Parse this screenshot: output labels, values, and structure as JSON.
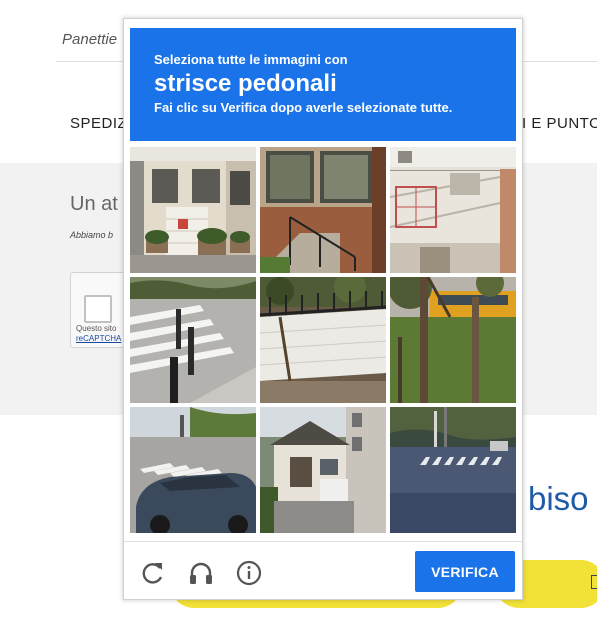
{
  "background": {
    "breadcrumb": "Panettie",
    "nav_left": "SPEDIZ",
    "nav_right": "I E PUNTO",
    "heading": "Un at",
    "subtext": "Abbiamo b",
    "recaptcha_line1": "Questo sito",
    "recaptcha_line2": "reCAPTCHA",
    "big_text": "biso"
  },
  "captcha": {
    "instruction_line1": "Seleziona tutte le immagini con",
    "target_object": "strisce pedonali",
    "instruction_line3": "Fai clic su Verifica dopo averle selezionate tutte.",
    "tiles": [
      {
        "name": "tile-1",
        "subject": "house with garage and plant pots"
      },
      {
        "name": "tile-2",
        "subject": "brick building with stair railing"
      },
      {
        "name": "tile-3",
        "subject": "white building with balconies"
      },
      {
        "name": "tile-4",
        "subject": "crosswalk with bollards"
      },
      {
        "name": "tile-5",
        "subject": "wall with iron fence"
      },
      {
        "name": "tile-6",
        "subject": "trees and yellow bus"
      },
      {
        "name": "tile-7",
        "subject": "car on street with crosswalk"
      },
      {
        "name": "tile-8",
        "subject": "house with driveway"
      },
      {
        "name": "tile-9",
        "subject": "road with crosswalk"
      }
    ],
    "footer": {
      "reload_icon": "reload-icon",
      "audio_icon": "headphones-icon",
      "info_icon": "info-icon",
      "verify_label": "VERIFICA"
    },
    "colors": {
      "accent": "#1a73e8"
    }
  }
}
